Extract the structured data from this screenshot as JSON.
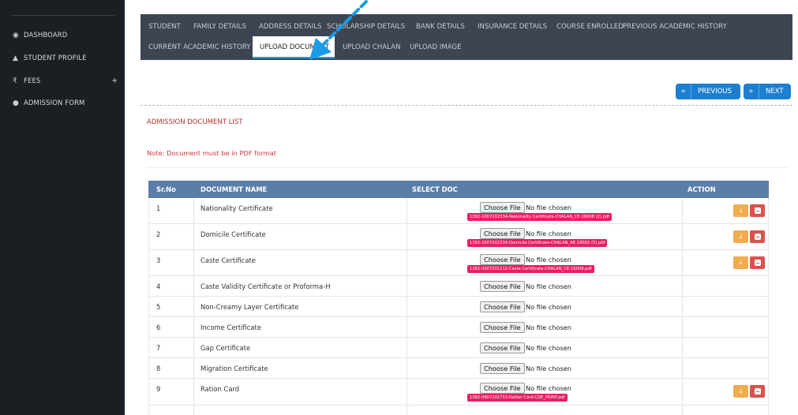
{
  "sidebar": {
    "items": [
      {
        "label": "DASHBOARD",
        "icon": "dashboard-icon"
      },
      {
        "label": "STUDENT PROFILE",
        "icon": "graduation-cap-icon"
      },
      {
        "label": "FEES",
        "icon": "rupee-icon"
      },
      {
        "label": "ADMISSION FORM",
        "icon": "user-icon"
      }
    ],
    "fees_expand": "+"
  },
  "tabs": {
    "row1": [
      "STUDENT",
      "FAMILY DETAILS",
      "ADDRESS DETAILS",
      "SCHOLARSHIP DETAILS",
      "BANK DETAILS",
      "INSURANCE DETAILS",
      "COURSE ENROLLED",
      "PREVIOUS ACADEMIC HISTORY"
    ],
    "row2": [
      "CURRENT ACADEMIC HISTORY",
      "UPLOAD DOCUMENT",
      "UPLOAD CHALAN",
      "UPLOAD IMAGE"
    ],
    "active": "UPLOAD DOCUMENT"
  },
  "nav": {
    "previous": "PREVIOUS",
    "next": "NEXT",
    "previous_icon": "«",
    "next_icon": "»"
  },
  "section": {
    "title": "ADMISSION DOCUMENT LIST",
    "note": "Note: Document must be in PDF format"
  },
  "table": {
    "headers": {
      "srno": "Sr.No",
      "name": "DOCUMENT NAME",
      "select": "SELECT DOC",
      "action": "ACTION"
    },
    "choose_label": "Choose File",
    "no_file": "No file chosen",
    "rows": [
      {
        "sr": "1",
        "name": "Nationality Certificate",
        "file": "1382-1007202334-Nationality Certificate-CHALAN_CE-16008 (2).pdf",
        "actions": true
      },
      {
        "sr": "2",
        "name": "Domicile Certificate",
        "file": "1382-1007202334-Domicile Certificate-CHALAN_AE-18002 (5).pdf",
        "actions": true
      },
      {
        "sr": "3",
        "name": "Caste Certificate",
        "file": "1382-0907201212-Caste Certificate-CHALAN_CE-16008.pdf",
        "actions": true
      },
      {
        "sr": "4",
        "name": "Caste Validity Certificate or Proforma-H",
        "file": "",
        "actions": false
      },
      {
        "sr": "5",
        "name": "Non-Creamy Layer Certificate",
        "file": "",
        "actions": false
      },
      {
        "sr": "6",
        "name": "Income Certificate",
        "file": "",
        "actions": false
      },
      {
        "sr": "7",
        "name": "Gap Certificate",
        "file": "",
        "actions": false
      },
      {
        "sr": "8",
        "name": "Migration Certificate",
        "file": "",
        "actions": false
      },
      {
        "sr": "9",
        "name": "Ration Card",
        "file": "1382-0907201753-Ration Card-COE_PRINT.pdf",
        "actions": true
      }
    ]
  },
  "colors": {
    "sidebar_bg": "#1b1f24",
    "tabs_bg": "#3d4452",
    "table_header_bg": "#5b7ea9",
    "primary_button": "#1e7fd1",
    "download_button": "#f0ad4e",
    "delete_button": "#d9534f",
    "file_badge": "#e91e63",
    "annotation_arrow": "#1a9be6"
  }
}
